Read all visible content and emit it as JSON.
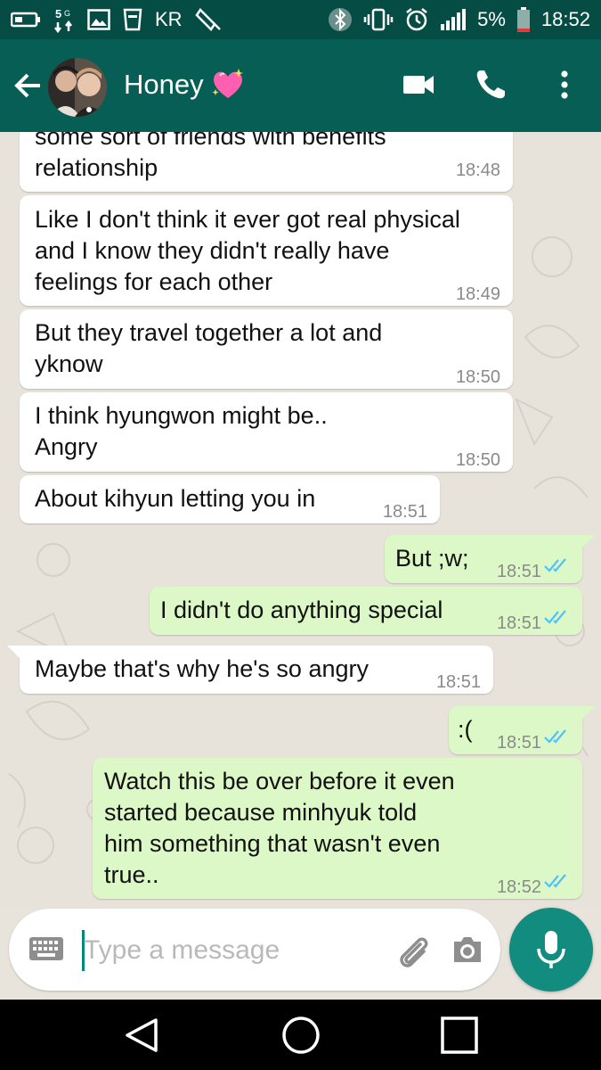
{
  "status_bar": {
    "carrier": "KR",
    "battery_percent": "5%",
    "time": "18:52",
    "left_icons": [
      "battery-outline-icon",
      "data-5g-icon",
      "image-icon",
      "trash-icon",
      "kakao-icon"
    ],
    "right_icons": [
      "bluetooth-icon",
      "vibrate-icon",
      "alarm-icon",
      "signal-icon",
      "battery-low-icon"
    ]
  },
  "header": {
    "contact_name": "Honey",
    "emoji": "sparkling-heart-icon",
    "icons": [
      "back-arrow-icon",
      "video-call-icon",
      "phone-icon",
      "more-vert-icon"
    ]
  },
  "messages": [
    {
      "dir": "in",
      "text": "some sort of friends with benefits\nrelationship",
      "time": "18:48"
    },
    {
      "dir": "in",
      "text": "Like I don't think it ever got real physical\nand I know they didn't really have\nfeelings for each other",
      "time": "18:49"
    },
    {
      "dir": "in",
      "text": "But they travel together a lot and\nyknow",
      "time": "18:50"
    },
    {
      "dir": "in",
      "text": "I think hyungwon might be..\nAngry",
      "time": "18:50"
    },
    {
      "dir": "in",
      "text": "About kihyun letting you in",
      "time": "18:51"
    },
    {
      "dir": "out",
      "text": "But ;w;",
      "time": "18:51"
    },
    {
      "dir": "out",
      "text": "I didn't do anything special",
      "time": "18:51"
    },
    {
      "dir": "in",
      "text": "Maybe that's why he's so angry",
      "time": "18:51"
    },
    {
      "dir": "out",
      "text": ":(",
      "time": "18:51"
    },
    {
      "dir": "out",
      "text": "Watch this be over before it even\nstarted because minhyuk told\nhim something that wasn't even\ntrue..",
      "time": "18:52"
    }
  ],
  "composer": {
    "placeholder": "Type a message",
    "icons": [
      "keyboard-icon",
      "attach-icon",
      "camera-icon",
      "mic-icon"
    ]
  },
  "nav": {
    "icons": [
      "nav-back-icon",
      "nav-home-icon",
      "nav-recents-icon"
    ]
  },
  "colors": {
    "status_bar": "#054d44",
    "app_bar": "#075e54",
    "incoming_bubble": "#ffffff",
    "outgoing_bubble": "#dcf8c6",
    "read_ticks": "#4fc3f7",
    "mic_button": "#128c7e"
  }
}
